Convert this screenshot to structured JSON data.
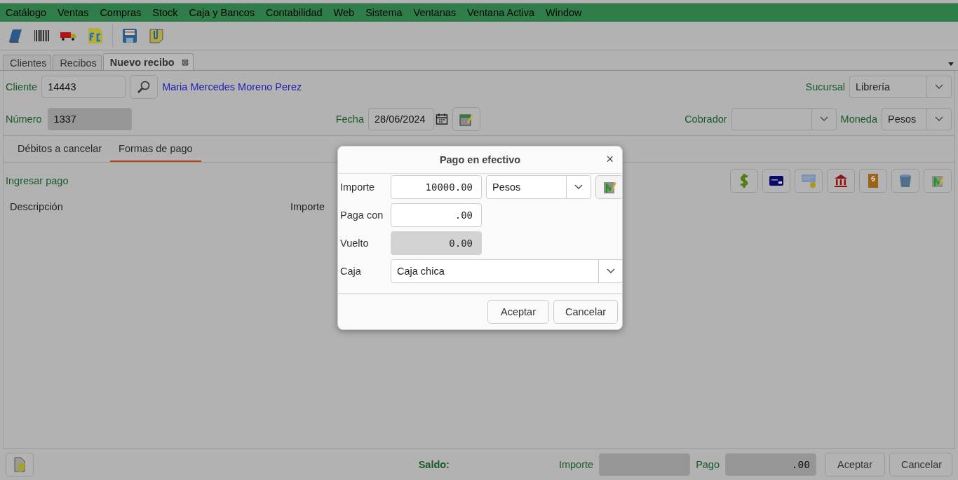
{
  "menu": [
    "Catálogo",
    "Ventas",
    "Compras",
    "Stock",
    "Caja y Bancos",
    "Contabilidad",
    "Web",
    "Sistema",
    "Ventanas",
    "Ventana Activa",
    "Window"
  ],
  "tabs": [
    {
      "label": "Clientes",
      "selected": false,
      "closable": false
    },
    {
      "label": "Recibos",
      "selected": false,
      "closable": false
    },
    {
      "label": "Nuevo recibo",
      "selected": true,
      "closable": true
    }
  ],
  "tab_close": "⊠",
  "cliente": {
    "label": "Cliente",
    "code": "14443",
    "name": "Maria Mercedes Moreno Perez"
  },
  "sucursal": {
    "label": "Sucursal",
    "value": "Librería"
  },
  "numero": {
    "label": "Número",
    "value": "1337"
  },
  "fecha": {
    "label": "Fecha",
    "value": "28/06/2024"
  },
  "cobrador": {
    "label": "Cobrador"
  },
  "moneda": {
    "label": "Moneda",
    "value": "Pesos"
  },
  "subtabs": [
    {
      "label": "Débitos a cancelar",
      "selected": false
    },
    {
      "label": "Formas de pago",
      "selected": true
    }
  ],
  "ingresar_pago": "Ingresar pago",
  "columns": [
    "Descripción",
    "Importe"
  ],
  "footer": {
    "saldo": "Saldo:",
    "importe_label": "Importe",
    "pago_label": "Pago",
    "pago_value": ".00",
    "buttons": [
      "Aceptar",
      "Cancelar"
    ]
  },
  "dialog": {
    "title": "Pago en efectivo",
    "close": "×",
    "importe": {
      "label": "Importe",
      "value": "10000.00",
      "currency": "Pesos"
    },
    "paga_con": {
      "label": "Paga con",
      "value": ".00"
    },
    "vuelto": {
      "label": "Vuelto",
      "value": "0.00"
    },
    "caja": {
      "label": "Caja",
      "value": "Caja chica"
    },
    "buttons": [
      "Aceptar",
      "Cancelar"
    ]
  }
}
